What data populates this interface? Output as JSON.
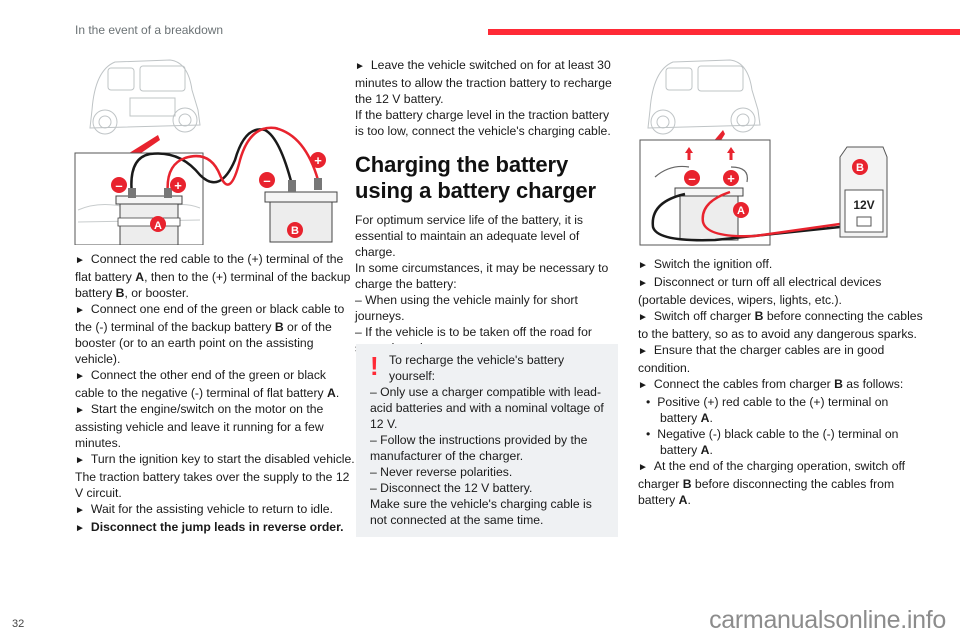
{
  "header": {
    "section_title": "In the event of a breakdown",
    "accent_color": "#ff2a36"
  },
  "figure1": {
    "label_a": "A",
    "label_b": "B",
    "minus": "–",
    "plus": "+"
  },
  "figure2": {
    "label_a": "A",
    "label_b": "B",
    "minus": "–",
    "plus": "+",
    "charger_voltage": "12V"
  },
  "column1": {
    "steps": [
      {
        "marker": "►",
        "parts": [
          "Connect the red cable to the (+) terminal of the flat battery ",
          "A",
          ", then to the (+) terminal of the backup battery ",
          "B",
          ", or booster."
        ]
      },
      {
        "marker": "►",
        "parts": [
          "Connect one end of the green or black cable to the (-) terminal of the backup battery ",
          "B",
          " or of the booster (or to an earth point on the assisting vehicle)."
        ]
      },
      {
        "marker": "►",
        "parts": [
          "Connect the other end of the green or black cable to the negative (-) terminal of flat battery ",
          "A",
          "."
        ]
      },
      {
        "marker": "►",
        "text": "Start the engine/switch on the motor on the assisting vehicle and leave it running for a few minutes."
      },
      {
        "marker": "►",
        "text": "Turn the ignition key to start the disabled vehicle."
      }
    ],
    "note": "The traction battery takes over the supply to the 12 V circuit.",
    "step_wait": {
      "marker": "►",
      "text": "Wait for the assisting vehicle to return to idle."
    },
    "step_final": {
      "marker": "►",
      "text": "Disconnect the jump leads in reverse order."
    }
  },
  "column2": {
    "step_leave": {
      "marker": "►",
      "text": "Leave the vehicle switched on for at least 30 minutes to allow the traction battery to recharge the 12 V battery."
    },
    "note_low": "If the battery charge level in the traction battery is too low, connect the vehicle's charging cable.",
    "section_heading": "Charging the battery using a battery charger",
    "intro": "For optimum service life of the battery, it is essential to maintain an adequate level of charge.",
    "circumstances": "In some circumstances, it may be necessary to charge the battery:",
    "dash_items": [
      "–  When using the vehicle mainly for short journeys.",
      "–  If the vehicle is to be taken off the road for several weeks."
    ],
    "warning": {
      "icon": "!",
      "title": "To recharge the vehicle's battery yourself:",
      "items": [
        "–  Only use a charger compatible with lead-acid batteries and with a nominal voltage of 12 V.",
        "–  Follow the instructions provided by the manufacturer of the charger.",
        "–  Never reverse polarities.",
        "–  Disconnect the 12 V battery."
      ],
      "footer": "Make sure the vehicle's charging cable is not connected at the same time."
    }
  },
  "column3": {
    "steps": [
      {
        "marker": "►",
        "text": "Switch the ignition off."
      },
      {
        "marker": "►",
        "text": "Disconnect or turn off all electrical devices (portable devices, wipers, lights, etc.)."
      },
      {
        "marker": "►",
        "parts": [
          "Switch off charger ",
          "B",
          " before connecting the cables to the battery, so as to avoid any dangerous sparks."
        ]
      },
      {
        "marker": "►",
        "text": "Ensure that the charger cables are in good condition."
      },
      {
        "marker": "►",
        "parts": [
          "Connect the cables from charger ",
          "B",
          " as follows:"
        ]
      }
    ],
    "bullets": [
      {
        "marker": "•",
        "parts": [
          "Positive (+) red cable to the (+) terminal on battery ",
          "A",
          "."
        ]
      },
      {
        "marker": "•",
        "parts": [
          "Negative (-) black cable to the (-) terminal on battery ",
          "A",
          "."
        ]
      }
    ],
    "step_end": {
      "marker": "►",
      "parts": [
        "At the end of the charging operation, switch off charger ",
        "B",
        " before disconnecting the cables from battery ",
        "A",
        "."
      ]
    }
  },
  "footer": {
    "page_number": "32",
    "watermark": "carmanualsonline.info"
  }
}
